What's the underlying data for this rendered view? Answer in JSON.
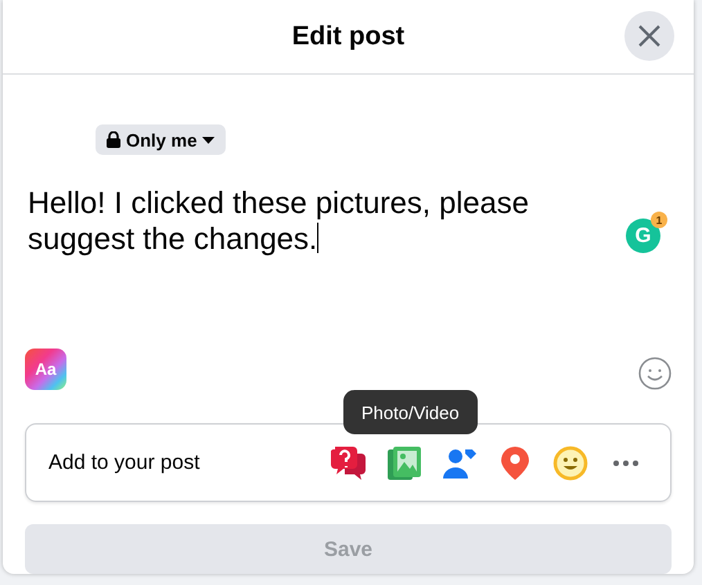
{
  "dialog": {
    "title": "Edit post"
  },
  "privacy": {
    "label": "Only me"
  },
  "post": {
    "text": "Hello! I clicked these pictures, please suggest the changes.",
    "grammar_logo": "G",
    "grammar_count": "1"
  },
  "text_style": {
    "label": "Aa"
  },
  "add_to_post": {
    "label": "Add to your post",
    "tooltip": "Photo/Video",
    "items": [
      {
        "kind": "question"
      },
      {
        "kind": "photo"
      },
      {
        "kind": "tag"
      },
      {
        "kind": "location"
      },
      {
        "kind": "feeling"
      },
      {
        "kind": "more"
      }
    ]
  },
  "save": {
    "label": "Save",
    "disabled": true
  }
}
